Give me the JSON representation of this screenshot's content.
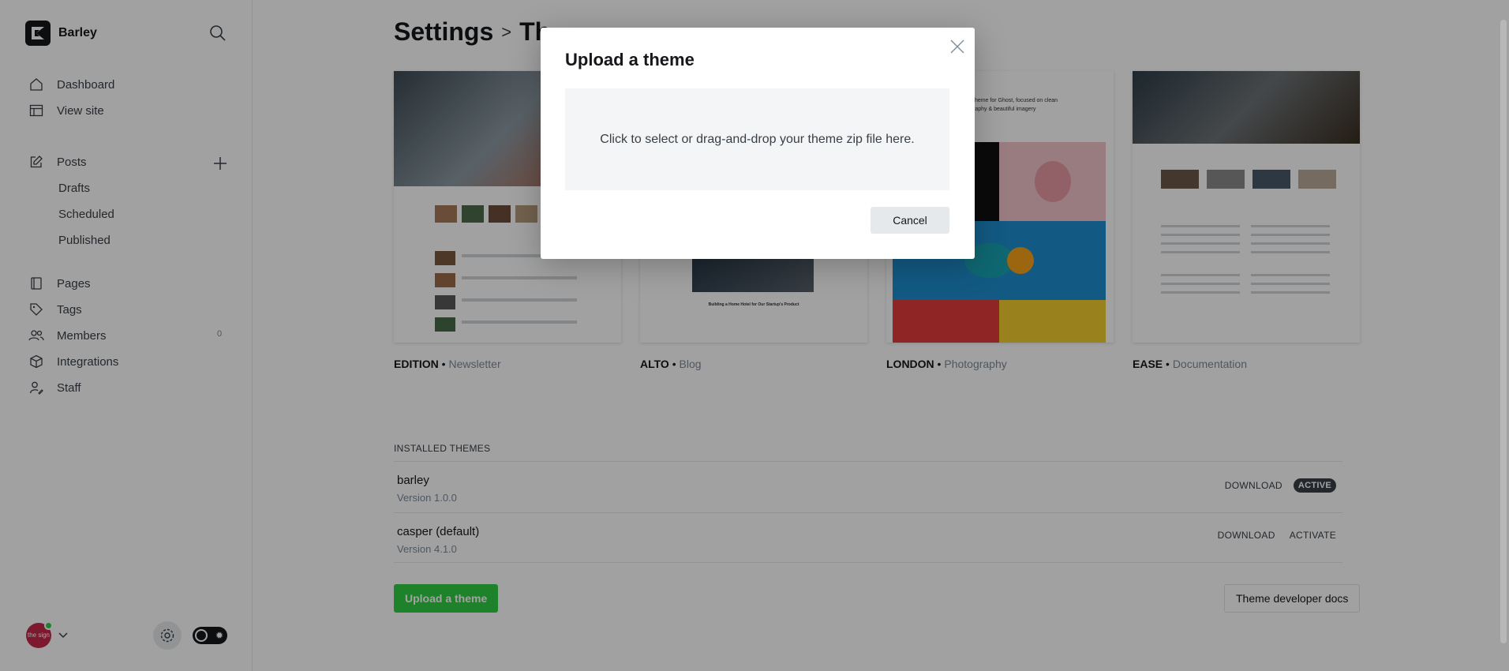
{
  "brand": {
    "name": "Barley"
  },
  "nav": {
    "dashboard": "Dashboard",
    "view_site": "View site",
    "posts": "Posts",
    "drafts": "Drafts",
    "scheduled": "Scheduled",
    "published": "Published",
    "pages": "Pages",
    "tags": "Tags",
    "members": "Members",
    "members_count": "0",
    "integrations": "Integrations",
    "staff": "Staff"
  },
  "user": {
    "avatar_text": "the sign"
  },
  "breadcrumb": {
    "parent": "Settings",
    "separator": ">",
    "current": "Th"
  },
  "themes_gallery": [
    {
      "name": "EDITION",
      "category": "Newsletter"
    },
    {
      "name": "ALTO",
      "category": "Blog"
    },
    {
      "name": "LONDON",
      "category": "Photography"
    },
    {
      "name": "EASE",
      "category": "Documentation"
    }
  ],
  "installed": {
    "heading": "INSTALLED THEMES",
    "rows": [
      {
        "name": "barley",
        "version": "Version 1.0.0",
        "download": "DOWNLOAD",
        "status": "ACTIVE"
      },
      {
        "name": "casper (default)",
        "version": "Version 4.1.0",
        "download": "DOWNLOAD",
        "action": "ACTIVATE"
      }
    ]
  },
  "buttons": {
    "upload": "Upload a theme",
    "dev_docs": "Theme developer docs"
  },
  "modal": {
    "title": "Upload a theme",
    "dropzone_text": "Click to select or drag-and-drop your theme zip file here.",
    "cancel": "Cancel"
  },
  "thumb_text": {
    "alto_headline": "Building a Home Hotel for Our Startup's Product",
    "london_tagline_1": "theme for Ghost, focused on clean",
    "london_tagline_2": "raphy & beautiful imagery"
  },
  "colors": {
    "accent_green": "#30cf43",
    "text": "#15171a",
    "muted": "#7c8b9a",
    "overlay": "rgba(0,0,0,0.37)"
  },
  "icons": [
    "logo-icon",
    "search-icon",
    "home-icon",
    "view-site-icon",
    "posts-icon",
    "plus-icon",
    "pages-icon",
    "tags-icon",
    "members-icon",
    "integrations-icon",
    "staff-icon",
    "chevron-down-icon",
    "gear-icon",
    "close-icon"
  ]
}
